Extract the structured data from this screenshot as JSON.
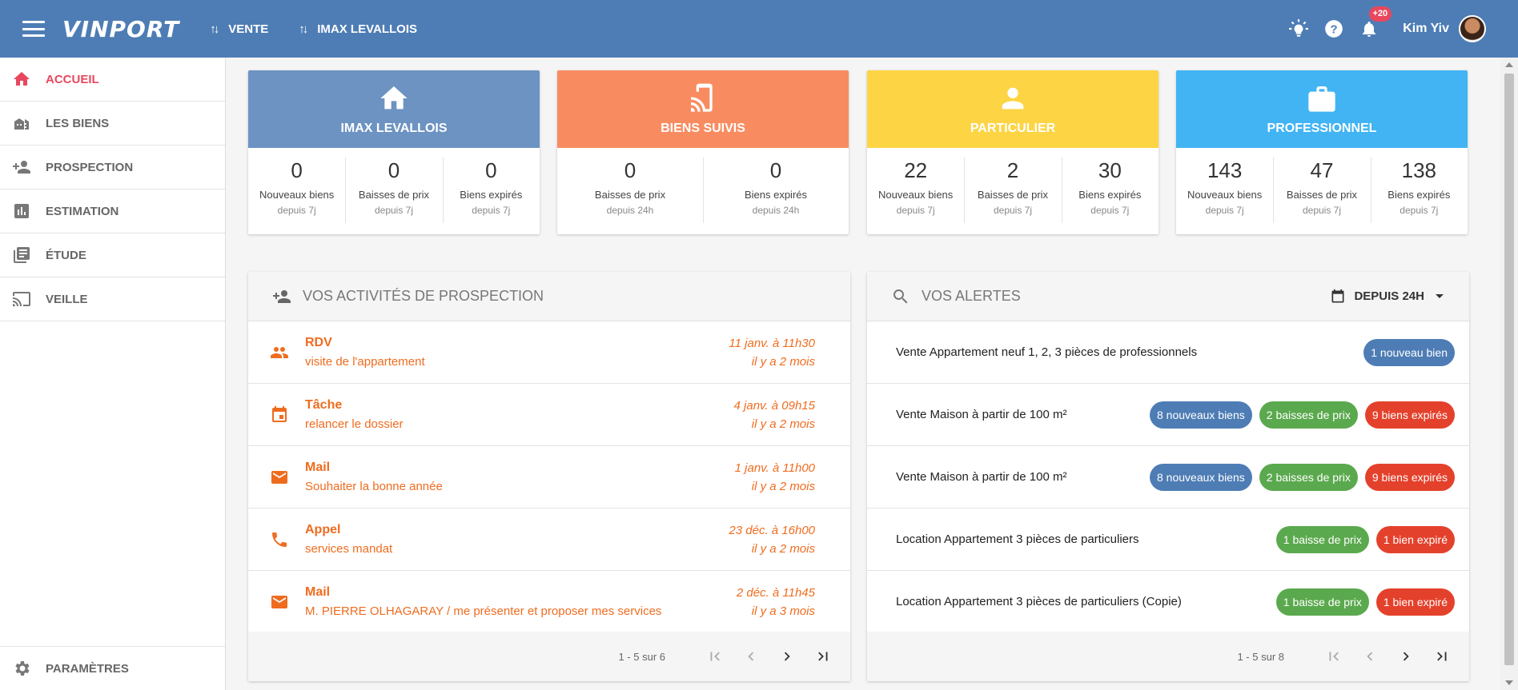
{
  "header": {
    "logo": "VINPORT",
    "nav": [
      {
        "label": "VENTE"
      },
      {
        "label": "IMAX LEVALLOIS"
      }
    ],
    "notification_count": "+20",
    "user_name": "Kim Yiv"
  },
  "sidebar": {
    "items": [
      {
        "label": "ACCUEIL",
        "icon": "home-icon"
      },
      {
        "label": "LES BIENS",
        "icon": "buildings-icon"
      },
      {
        "label": "PROSPECTION",
        "icon": "person-add-icon"
      },
      {
        "label": "ESTIMATION",
        "icon": "bar-chart-icon"
      },
      {
        "label": "ÉTUDE",
        "icon": "library-books-icon"
      },
      {
        "label": "VEILLE",
        "icon": "cast-icon"
      }
    ],
    "settings_label": "PARAMÈTRES"
  },
  "cards": [
    {
      "title": "IMAX LEVALLOIS",
      "color": "#6c93c2",
      "icon": "home-icon",
      "stats": [
        {
          "value": "0",
          "label": "Nouveaux biens",
          "sub": "depuis 7j"
        },
        {
          "value": "0",
          "label": "Baisses de prix",
          "sub": "depuis 7j"
        },
        {
          "value": "0",
          "label": "Biens expirés",
          "sub": "depuis 7j"
        }
      ]
    },
    {
      "title": "BIENS SUIVIS",
      "color": "#f88c60",
      "icon": "cast-icon",
      "stats": [
        {
          "value": "0",
          "label": "Baisses de prix",
          "sub": "depuis 24h"
        },
        {
          "value": "0",
          "label": "Biens expirés",
          "sub": "depuis 24h"
        }
      ]
    },
    {
      "title": "PARTICULIER",
      "color": "#fdd444",
      "icon": "person-icon",
      "stats": [
        {
          "value": "22",
          "label": "Nouveaux biens",
          "sub": "depuis 7j"
        },
        {
          "value": "2",
          "label": "Baisses de prix",
          "sub": "depuis 7j"
        },
        {
          "value": "30",
          "label": "Biens expirés",
          "sub": "depuis 7j"
        }
      ]
    },
    {
      "title": "PROFESSIONNEL",
      "color": "#42b4f4",
      "icon": "briefcase-icon",
      "stats": [
        {
          "value": "143",
          "label": "Nouveaux biens",
          "sub": "depuis 7j"
        },
        {
          "value": "47",
          "label": "Baisses de prix",
          "sub": "depuis 7j"
        },
        {
          "value": "138",
          "label": "Biens expirés",
          "sub": "depuis 7j"
        }
      ]
    }
  ],
  "activities": {
    "title": "VOS ACTIVITÉS DE PROSPECTION",
    "rows": [
      {
        "type": "RDV",
        "desc": "visite de l'appartement",
        "date": "11 janv. à 11h30",
        "ago": "il y a 2 mois",
        "icon": "people-icon"
      },
      {
        "type": "Tâche",
        "desc": "relancer le dossier",
        "date": "4 janv. à 09h15",
        "ago": "il y a 2 mois",
        "icon": "calendar-icon"
      },
      {
        "type": "Mail",
        "desc": "Souhaiter la bonne année",
        "date": "1 janv. à 11h00",
        "ago": "il y a 2 mois",
        "icon": "mail-icon"
      },
      {
        "type": "Appel",
        "desc": "services mandat",
        "date": "23 déc. à 16h00",
        "ago": "il y a 2 mois",
        "icon": "phone-icon"
      },
      {
        "type": "Mail",
        "desc": "M. PIERRE OLHAGARAY / me présenter et proposer mes services",
        "date": "2 déc. à 11h45",
        "ago": "il y a 3 mois",
        "icon": "mail-icon"
      }
    ],
    "pager": "1 - 5 sur 6"
  },
  "alerts": {
    "title": "VOS ALERTES",
    "filter_label": "DEPUIS 24H",
    "rows": [
      {
        "text": "Vente Appartement neuf 1, 2, 3 pièces de professionnels",
        "chips": [
          {
            "label": "1 nouveau bien",
            "color": "blue"
          }
        ]
      },
      {
        "text": "Vente Maison à partir de 100 m²",
        "chips": [
          {
            "label": "8 nouveaux biens",
            "color": "blue"
          },
          {
            "label": "2 baisses de prix",
            "color": "green"
          },
          {
            "label": "9 biens expirés",
            "color": "red"
          }
        ]
      },
      {
        "text": "Vente Maison à partir de 100 m²",
        "chips": [
          {
            "label": "8 nouveaux biens",
            "color": "blue"
          },
          {
            "label": "2 baisses de prix",
            "color": "green"
          },
          {
            "label": "9 biens expirés",
            "color": "red"
          }
        ]
      },
      {
        "text": "Location Appartement 3 pièces de particuliers",
        "chips": [
          {
            "label": "1 baisse de prix",
            "color": "green"
          },
          {
            "label": "1 bien expiré",
            "color": "red"
          }
        ]
      },
      {
        "text": "Location Appartement 3 pièces de particuliers (Copie)",
        "chips": [
          {
            "label": "1 baisse de prix",
            "color": "green"
          },
          {
            "label": "1 bien expiré",
            "color": "red"
          }
        ]
      }
    ],
    "pager": "1 - 5 sur 8"
  },
  "colors": {
    "header": "#4e7db5",
    "accent_active": "#e8475d",
    "activity_text": "#ef6c1f"
  }
}
